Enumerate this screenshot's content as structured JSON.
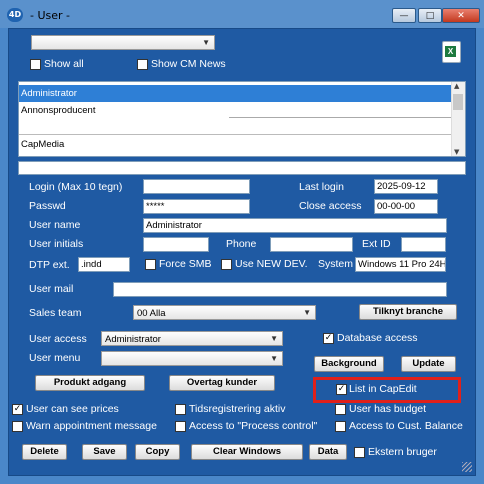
{
  "window": {
    "title": "- User -",
    "app_icon": "4D",
    "min": "—",
    "max": "□",
    "close": "✕"
  },
  "top": {
    "show_all": "Show all",
    "show_cm_news": "Show CM News",
    "excel_icon": "excel-icon"
  },
  "user_list": {
    "items": [
      "Administrator",
      "Annonsproducent",
      "",
      "CapMedia"
    ],
    "selected_index": 0
  },
  "fields": {
    "login_label": "Login (Max 10 tegn)",
    "login_value": "",
    "passwd_label": "Passwd",
    "passwd_value": "*****",
    "user_name_label": "User name",
    "user_name_value": "Administrator",
    "user_initials_label": "User initials",
    "user_initials_value": "",
    "phone_label": "Phone",
    "phone_value": "",
    "ext_id_label": "Ext ID",
    "ext_id_value": "",
    "last_login_label": "Last login",
    "last_login_value": "2025-09-12",
    "close_access_label": "Close access",
    "close_access_value": "00-00-00",
    "dtp_ext_label": "DTP ext.",
    "dtp_ext_value": ".indd",
    "force_smb": "Force SMB",
    "use_new_dev": "Use NEW DEV.",
    "system_label": "System",
    "system_value": "Windows 11 Pro 24H",
    "user_mail_label": "User mail",
    "user_mail_value": "",
    "sales_team_label": "Sales team",
    "sales_team_value": "00 Alla",
    "tilknyt_branche": "Tilknyt branche",
    "user_access_label": "User access",
    "user_access_value": "Administrator",
    "database_access": "Database access",
    "user_menu_label": "User menu",
    "user_menu_value": ""
  },
  "buttons": {
    "background": "Background",
    "update": "Update",
    "produkt_adgang": "Produkt adgang",
    "overtag_kunder": "Overtag kunder",
    "delete": "Delete",
    "save": "Save",
    "copy": "Copy",
    "clear_windows": "Clear Windows",
    "data": "Data"
  },
  "checks": {
    "list_in_capedit": "List in CapEdit",
    "user_can_see_prices": "User can see prices",
    "tidsregistrering": "Tidsregistrering aktiv",
    "user_has_budget": "User has budget",
    "warn_appointment": "Warn appointment message",
    "access_process_control": "Access to \"Process control\"",
    "access_cust_balance": "Access to Cust. Balance",
    "ekstern_bruger": "Ekstern bruger"
  },
  "colors": {
    "form_bg": "#1f5aa3",
    "titlebar": "#5a91cc",
    "highlight": "#e0201a",
    "selection": "#2e7fd6"
  }
}
